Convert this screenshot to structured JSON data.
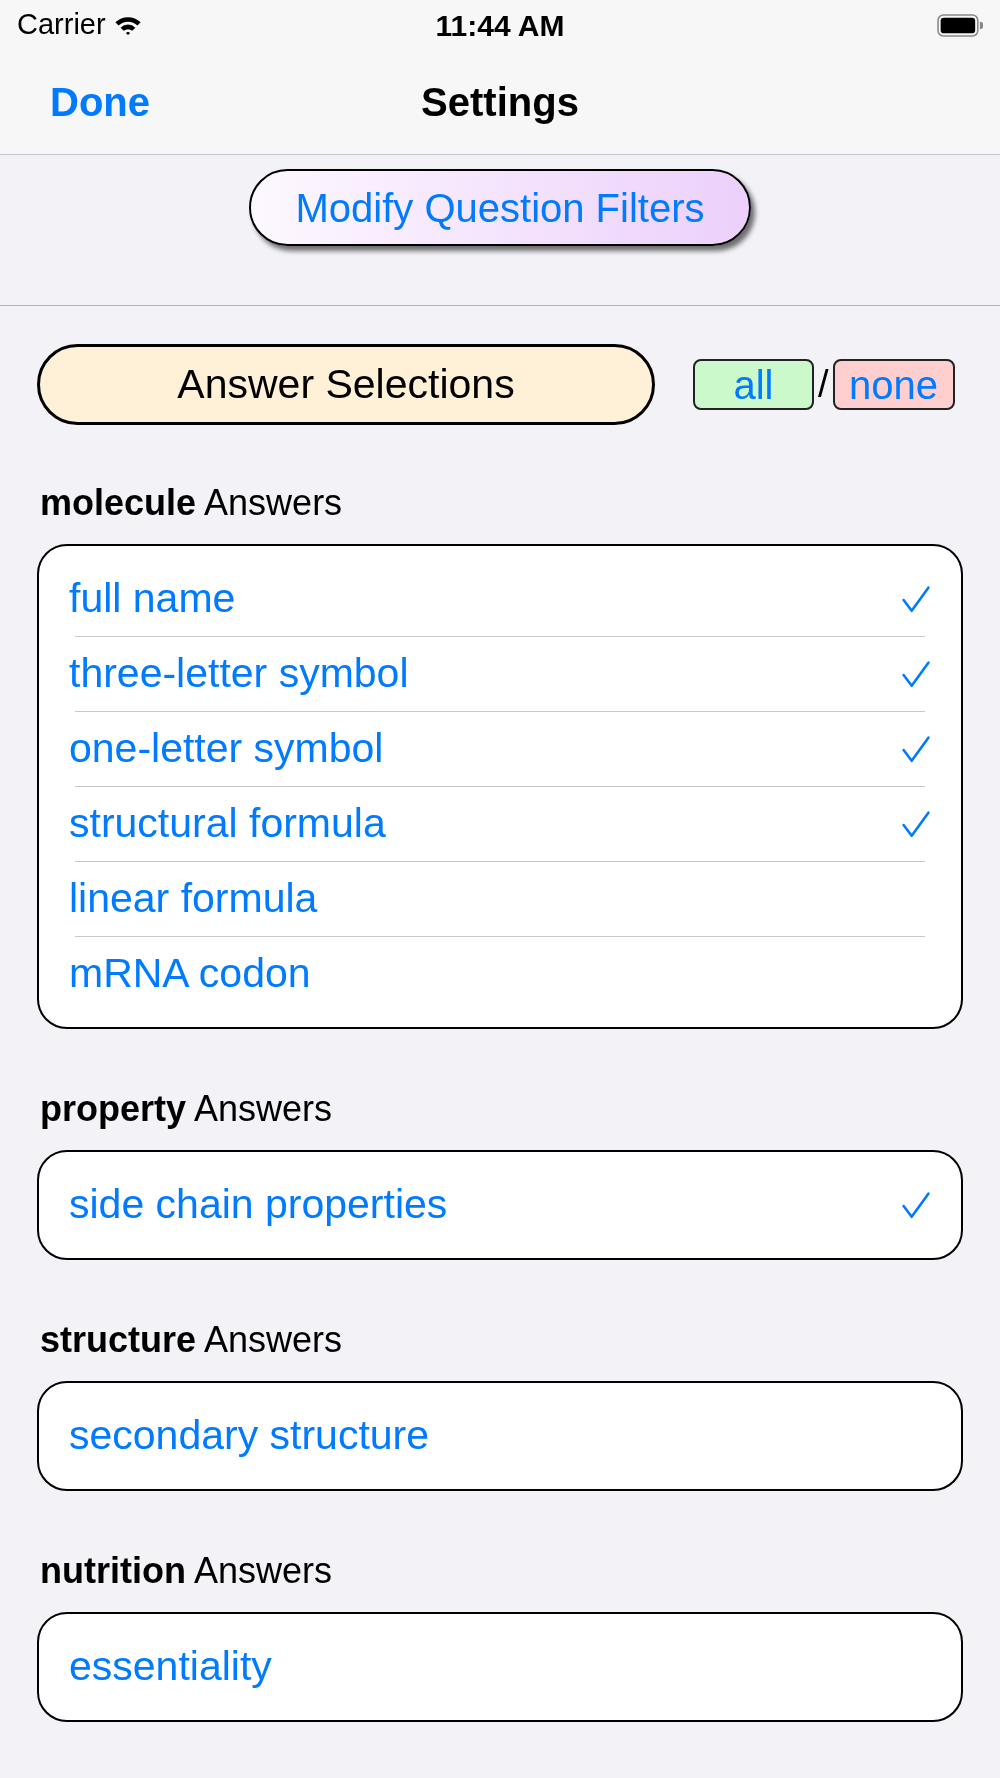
{
  "status_bar": {
    "carrier": "Carrier",
    "time": "11:44 AM"
  },
  "nav_bar": {
    "done_button": "Done",
    "title": "Settings"
  },
  "filter_button": "Modify Question Filters",
  "answer_selections": {
    "label": "Answer Selections",
    "all_button": "all",
    "separator": "/",
    "none_button": "none"
  },
  "sections": [
    {
      "heading": "**molecule** Answers",
      "items": [
        {
          "label": "full name",
          "checked": true
        },
        {
          "label": "three-letter symbol",
          "checked": true
        },
        {
          "label": "one-letter symbol",
          "checked": true
        },
        {
          "label": "structural formula",
          "checked": true
        },
        {
          "label": "linear formula",
          "checked": false
        },
        {
          "label": "mRNA codon",
          "checked": false
        }
      ]
    },
    {
      "heading": "**property** Answers",
      "items": [
        {
          "label": "side chain properties",
          "checked": true
        }
      ]
    },
    {
      "heading": "**structure** Answers",
      "items": [
        {
          "label": "secondary structure",
          "checked": false
        }
      ]
    },
    {
      "heading": "**nutrition** Answers",
      "items": [
        {
          "label": "essentiality",
          "checked": false
        }
      ]
    }
  ]
}
